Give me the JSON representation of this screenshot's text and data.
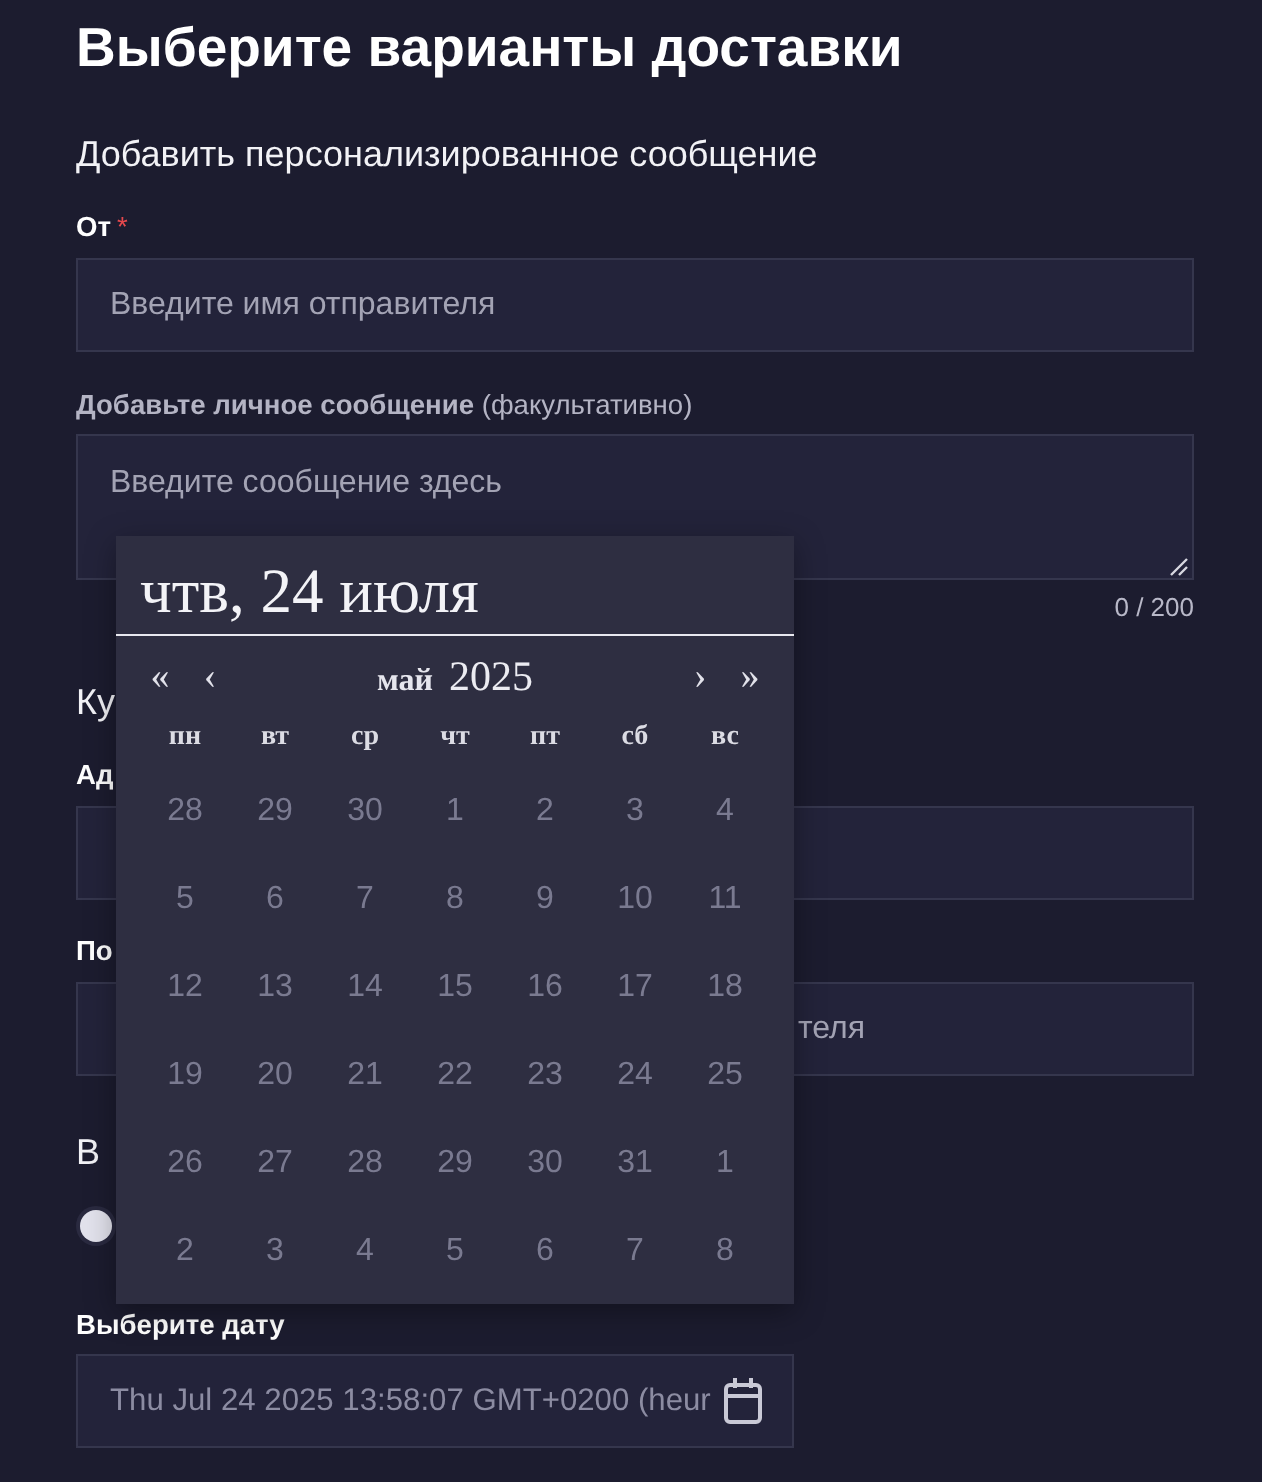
{
  "title": "Выберите варианты доставки",
  "message_section": {
    "heading": "Добавить персонализированное сообщение",
    "sender": {
      "label": "От",
      "required_mark": "*",
      "placeholder": "Введите имя отправителя"
    },
    "message": {
      "label": "**Добавьте личное сообщение** (факультативно)",
      "placeholder": "Введите сообщение здесь",
      "counter": "0 / 200"
    }
  },
  "recipient_section": {
    "heading": "Ку",
    "address": {
      "label": "Ад"
    },
    "second_field": {
      "label": "По",
      "placeholder": "теля"
    }
  },
  "delivery_section": {
    "heading": "В",
    "toggle": {
      "on": false
    },
    "date": {
      "label": "Выберите дату",
      "value": "Thu Jul 24 2025 13:58:07 GMT+0200 (heur"
    }
  },
  "date_picker": {
    "selected_date": "чтв, 24 июля",
    "nav": {
      "first": "«",
      "prev": "‹",
      "next": "›",
      "last": "»"
    },
    "month": "май",
    "year": "2025",
    "weekdays": [
      "пн",
      "вт",
      "ср",
      "чт",
      "пт",
      "сб",
      "вс"
    ],
    "weeks": [
      [
        {
          "label": "28",
          "disabled": true
        },
        {
          "label": "29",
          "disabled": true
        },
        {
          "label": "30",
          "disabled": true
        },
        {
          "label": "1",
          "disabled": true
        },
        {
          "label": "2",
          "disabled": true
        },
        {
          "label": "3",
          "disabled": true
        },
        {
          "label": "4",
          "disabled": true
        }
      ],
      [
        {
          "label": "5",
          "disabled": true
        },
        {
          "label": "6",
          "disabled": true
        },
        {
          "label": "7",
          "disabled": true
        },
        {
          "label": "8",
          "disabled": true
        },
        {
          "label": "9",
          "disabled": true
        },
        {
          "label": "10",
          "disabled": true
        },
        {
          "label": "11",
          "disabled": true
        }
      ],
      [
        {
          "label": "12",
          "disabled": true
        },
        {
          "label": "13",
          "disabled": true
        },
        {
          "label": "14",
          "disabled": true
        },
        {
          "label": "15",
          "disabled": true
        },
        {
          "label": "16",
          "disabled": true
        },
        {
          "label": "17",
          "disabled": true
        },
        {
          "label": "18",
          "disabled": true
        }
      ],
      [
        {
          "label": "19",
          "disabled": true
        },
        {
          "label": "20",
          "disabled": true
        },
        {
          "label": "21",
          "disabled": true
        },
        {
          "label": "22",
          "disabled": true
        },
        {
          "label": "23",
          "disabled": true
        },
        {
          "label": "24",
          "disabled": true
        },
        {
          "label": "25",
          "disabled": true
        }
      ],
      [
        {
          "label": "26",
          "disabled": true
        },
        {
          "label": "27",
          "disabled": true
        },
        {
          "label": "28",
          "disabled": true
        },
        {
          "label": "29",
          "disabled": true
        },
        {
          "label": "30",
          "disabled": true
        },
        {
          "label": "31",
          "disabled": true
        },
        {
          "label": "1",
          "disabled": true
        }
      ],
      [
        {
          "label": "2",
          "disabled": true
        },
        {
          "label": "3",
          "disabled": true
        },
        {
          "label": "4",
          "disabled": true
        },
        {
          "label": "5",
          "disabled": true
        },
        {
          "label": "6",
          "disabled": true
        },
        {
          "label": "7",
          "disabled": true
        },
        {
          "label": "8",
          "disabled": true
        }
      ]
    ]
  }
}
